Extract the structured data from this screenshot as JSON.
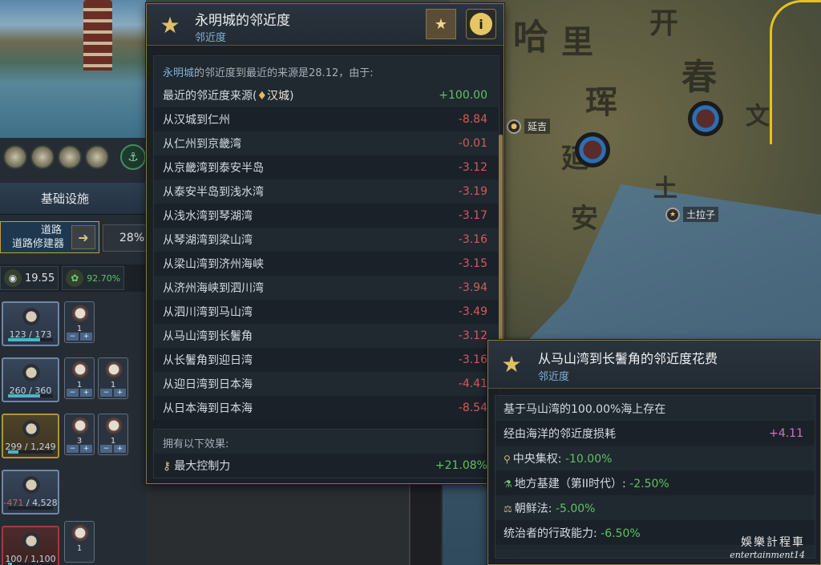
{
  "left_panel": {
    "section_title": "基础设施",
    "road": {
      "title": "道路",
      "subtitle": "道路修建器",
      "percent": "28%"
    },
    "stats": {
      "goods": "19.55",
      "growth": "92.70%"
    },
    "pops": [
      {
        "value": "123",
        "max": "173",
        "style": "blue",
        "fill": 0.71
      },
      {
        "value": "260",
        "max": "360",
        "style": "blue",
        "fill": 0.72
      },
      {
        "value": "299",
        "max": "1,249",
        "style": "gold",
        "fill": 0.24
      },
      {
        "value": "-471",
        "max": "4,528",
        "style": "blue",
        "fill": 0.0
      },
      {
        "value": "100",
        "max": "1,100",
        "style": "red",
        "fill": 0.09
      }
    ],
    "buildings": [
      {
        "count": "1"
      },
      {
        "count": "1"
      },
      {
        "count": "1"
      },
      {
        "count": "3"
      },
      {
        "count": "1"
      },
      {
        "count": "1"
      }
    ],
    "control_minus": "−",
    "control_plus": "+"
  },
  "tooltip_main": {
    "title": "永明城的邻近度",
    "subtitle": "邻近度",
    "intro_city": "永明城",
    "intro_text": "的邻近度到最近的来源是28.12，由于:",
    "rows": [
      {
        "label": "最近的邻近度来源(",
        "place": "汉城",
        "suffix": ")",
        "value": "+100.00",
        "positive": true
      },
      {
        "label": "从汉城到仁州",
        "value": "-8.84"
      },
      {
        "label": "从仁州到京畿湾",
        "value": "-0.01"
      },
      {
        "label": "从京畿湾到泰安半岛",
        "value": "-3.12"
      },
      {
        "label": "从泰安半岛到浅水湾",
        "value": "-3.19"
      },
      {
        "label": "从浅水湾到琴湖湾",
        "value": "-3.17"
      },
      {
        "label": "从琴湖湾到梁山湾",
        "value": "-3.16"
      },
      {
        "label": "从梁山湾到济州海峡",
        "value": "-3.15"
      },
      {
        "label": "从济州海峡到泗川湾",
        "value": "-3.94"
      },
      {
        "label": "从泗川湾到马山湾",
        "value": "-3.49"
      },
      {
        "label": "从马山湾到长鬐角",
        "value": "-3.12"
      },
      {
        "label": "从长鬐角到迎日湾",
        "value": "-3.16"
      },
      {
        "label": "从迎日湾到日本海",
        "value": "-4.41"
      },
      {
        "label": "从日本海到日本海",
        "value": "-8.54"
      }
    ],
    "effects_header": "拥有以下效果:",
    "effect": {
      "label": "最大控制力",
      "value": "+21.08%"
    }
  },
  "tooltip_cost": {
    "title": "从马山湾到长鬐角的邻近度花费",
    "subtitle": "邻近度",
    "rows": [
      {
        "label": "基于马山湾的100.00%海上存在",
        "value": ""
      },
      {
        "label": "经由海洋的邻近度损耗",
        "value": "+4.11"
      },
      {
        "label": "中央集权:",
        "value": "-10.00%"
      },
      {
        "label": "地方基建（第II时代）:",
        "value": "-2.50%"
      },
      {
        "label": "朝鲜法:",
        "value": "-5.00%"
      },
      {
        "label": "统治者的行政能力:",
        "value": "-6.50%"
      }
    ]
  },
  "map": {
    "labels": [
      {
        "name": "延吉"
      },
      {
        "name": "土拉子"
      }
    ],
    "chars": [
      "哈",
      "里",
      "开",
      "珲",
      "春",
      "文",
      "延",
      "安",
      "土"
    ]
  },
  "watermark": {
    "line1": "娛樂計程車",
    "line2": "entertainment14"
  },
  "colors": {
    "positive": "#5fc362",
    "negative": "#d45b5b",
    "accent": "#7fb3d8",
    "gold_border": "#8a7544",
    "magenta": "#d473c5"
  }
}
